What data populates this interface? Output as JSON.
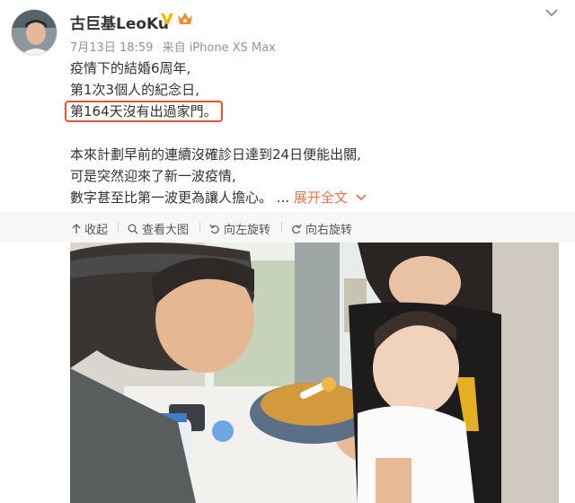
{
  "header": {
    "username": "古巨基LeoKu",
    "verified_icon": "verified-v-icon",
    "vip_icon": "vip-crown-icon",
    "menu_icon": "chevron-down-icon",
    "timestamp": "7月13日 18:59",
    "source": "来自 iPhone XS Max"
  },
  "post": {
    "lines": [
      "疫情下的結婚6周年,",
      "第1次3個人的紀念日,",
      "第164天沒有出過家門。",
      "本來計劃早前的連續沒確診日達到24日便能出關,",
      "可是突然迎來了新一波疫情,",
      "數字甚至比第一波更為讓人擔心。"
    ],
    "ellipsis": "...",
    "expand_label": "展开全文"
  },
  "toolbar": {
    "collapse_label": "收起",
    "view_large_label": "查看大图",
    "rotate_left_label": "向左旋转",
    "rotate_right_label": "向右旋转"
  },
  "colors": {
    "accent": "#eb7350",
    "highlight_border": "#e8542d",
    "verified": "#f5b700",
    "toolbar_bg": "#f7f7f7"
  }
}
